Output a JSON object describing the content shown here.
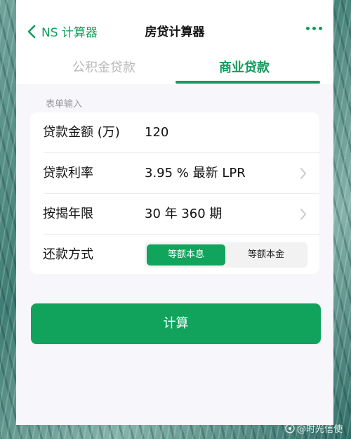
{
  "header": {
    "back_label": "NS 计算器",
    "title": "房贷计算器"
  },
  "tabs": [
    {
      "label": "公积金贷款",
      "active": false
    },
    {
      "label": "商业贷款",
      "active": true
    }
  ],
  "section_label": "表单输入",
  "form": {
    "amount": {
      "label": "贷款金额 (万)",
      "value": "120"
    },
    "rate": {
      "label": "贷款利率",
      "value": "3.95 %  最新 LPR"
    },
    "term": {
      "label": "按揭年限",
      "value": "30 年  360 期"
    },
    "method": {
      "label": "还款方式",
      "options": [
        {
          "label": "等额本息",
          "selected": true
        },
        {
          "label": "等额本金",
          "selected": false
        }
      ]
    }
  },
  "calculate_label": "计算",
  "watermark": "@时光信使",
  "colors": {
    "accent": "#11a35c",
    "page_bg": "#f6f6fb",
    "inactive_tab": "#b8b8b8"
  },
  "icons": {
    "back": "chevron-left-icon",
    "more": "more-dots-icon",
    "row_arrow": "chevron-right-icon"
  }
}
